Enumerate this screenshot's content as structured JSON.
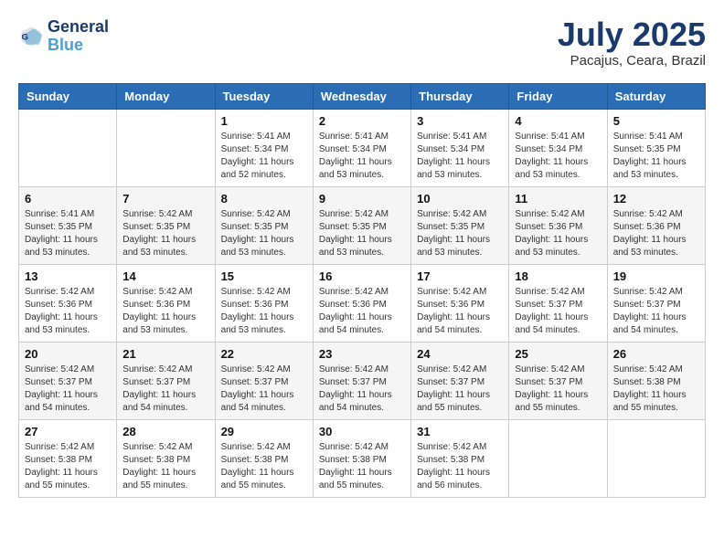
{
  "header": {
    "logo_line1": "General",
    "logo_line2": "Blue",
    "month_year": "July 2025",
    "location": "Pacajus, Ceara, Brazil"
  },
  "weekdays": [
    "Sunday",
    "Monday",
    "Tuesday",
    "Wednesday",
    "Thursday",
    "Friday",
    "Saturday"
  ],
  "weeks": [
    [
      {
        "day": "",
        "detail": ""
      },
      {
        "day": "",
        "detail": ""
      },
      {
        "day": "1",
        "detail": "Sunrise: 5:41 AM\nSunset: 5:34 PM\nDaylight: 11 hours and 52 minutes."
      },
      {
        "day": "2",
        "detail": "Sunrise: 5:41 AM\nSunset: 5:34 PM\nDaylight: 11 hours and 53 minutes."
      },
      {
        "day": "3",
        "detail": "Sunrise: 5:41 AM\nSunset: 5:34 PM\nDaylight: 11 hours and 53 minutes."
      },
      {
        "day": "4",
        "detail": "Sunrise: 5:41 AM\nSunset: 5:34 PM\nDaylight: 11 hours and 53 minutes."
      },
      {
        "day": "5",
        "detail": "Sunrise: 5:41 AM\nSunset: 5:35 PM\nDaylight: 11 hours and 53 minutes."
      }
    ],
    [
      {
        "day": "6",
        "detail": "Sunrise: 5:41 AM\nSunset: 5:35 PM\nDaylight: 11 hours and 53 minutes."
      },
      {
        "day": "7",
        "detail": "Sunrise: 5:42 AM\nSunset: 5:35 PM\nDaylight: 11 hours and 53 minutes."
      },
      {
        "day": "8",
        "detail": "Sunrise: 5:42 AM\nSunset: 5:35 PM\nDaylight: 11 hours and 53 minutes."
      },
      {
        "day": "9",
        "detail": "Sunrise: 5:42 AM\nSunset: 5:35 PM\nDaylight: 11 hours and 53 minutes."
      },
      {
        "day": "10",
        "detail": "Sunrise: 5:42 AM\nSunset: 5:35 PM\nDaylight: 11 hours and 53 minutes."
      },
      {
        "day": "11",
        "detail": "Sunrise: 5:42 AM\nSunset: 5:36 PM\nDaylight: 11 hours and 53 minutes."
      },
      {
        "day": "12",
        "detail": "Sunrise: 5:42 AM\nSunset: 5:36 PM\nDaylight: 11 hours and 53 minutes."
      }
    ],
    [
      {
        "day": "13",
        "detail": "Sunrise: 5:42 AM\nSunset: 5:36 PM\nDaylight: 11 hours and 53 minutes."
      },
      {
        "day": "14",
        "detail": "Sunrise: 5:42 AM\nSunset: 5:36 PM\nDaylight: 11 hours and 53 minutes."
      },
      {
        "day": "15",
        "detail": "Sunrise: 5:42 AM\nSunset: 5:36 PM\nDaylight: 11 hours and 53 minutes."
      },
      {
        "day": "16",
        "detail": "Sunrise: 5:42 AM\nSunset: 5:36 PM\nDaylight: 11 hours and 54 minutes."
      },
      {
        "day": "17",
        "detail": "Sunrise: 5:42 AM\nSunset: 5:36 PM\nDaylight: 11 hours and 54 minutes."
      },
      {
        "day": "18",
        "detail": "Sunrise: 5:42 AM\nSunset: 5:37 PM\nDaylight: 11 hours and 54 minutes."
      },
      {
        "day": "19",
        "detail": "Sunrise: 5:42 AM\nSunset: 5:37 PM\nDaylight: 11 hours and 54 minutes."
      }
    ],
    [
      {
        "day": "20",
        "detail": "Sunrise: 5:42 AM\nSunset: 5:37 PM\nDaylight: 11 hours and 54 minutes."
      },
      {
        "day": "21",
        "detail": "Sunrise: 5:42 AM\nSunset: 5:37 PM\nDaylight: 11 hours and 54 minutes."
      },
      {
        "day": "22",
        "detail": "Sunrise: 5:42 AM\nSunset: 5:37 PM\nDaylight: 11 hours and 54 minutes."
      },
      {
        "day": "23",
        "detail": "Sunrise: 5:42 AM\nSunset: 5:37 PM\nDaylight: 11 hours and 54 minutes."
      },
      {
        "day": "24",
        "detail": "Sunrise: 5:42 AM\nSunset: 5:37 PM\nDaylight: 11 hours and 55 minutes."
      },
      {
        "day": "25",
        "detail": "Sunrise: 5:42 AM\nSunset: 5:37 PM\nDaylight: 11 hours and 55 minutes."
      },
      {
        "day": "26",
        "detail": "Sunrise: 5:42 AM\nSunset: 5:38 PM\nDaylight: 11 hours and 55 minutes."
      }
    ],
    [
      {
        "day": "27",
        "detail": "Sunrise: 5:42 AM\nSunset: 5:38 PM\nDaylight: 11 hours and 55 minutes."
      },
      {
        "day": "28",
        "detail": "Sunrise: 5:42 AM\nSunset: 5:38 PM\nDaylight: 11 hours and 55 minutes."
      },
      {
        "day": "29",
        "detail": "Sunrise: 5:42 AM\nSunset: 5:38 PM\nDaylight: 11 hours and 55 minutes."
      },
      {
        "day": "30",
        "detail": "Sunrise: 5:42 AM\nSunset: 5:38 PM\nDaylight: 11 hours and 55 minutes."
      },
      {
        "day": "31",
        "detail": "Sunrise: 5:42 AM\nSunset: 5:38 PM\nDaylight: 11 hours and 56 minutes."
      },
      {
        "day": "",
        "detail": ""
      },
      {
        "day": "",
        "detail": ""
      }
    ]
  ]
}
